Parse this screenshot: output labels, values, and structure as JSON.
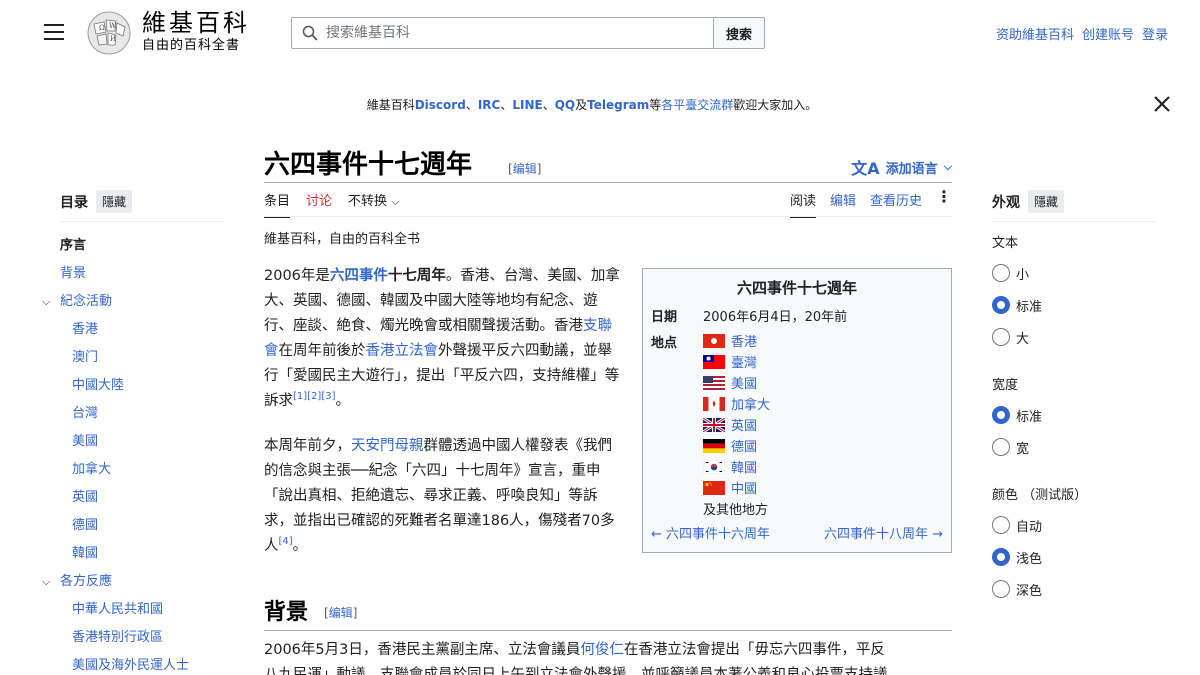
{
  "header": {
    "wordmark_title": "維基百科",
    "wordmark_tagline": "自由的百科全書",
    "search_placeholder": "搜索維基百科",
    "search_button": "搜索",
    "user_links": [
      "资助維基百科",
      "创建账号",
      "登录"
    ]
  },
  "banner": {
    "t1": "維基百科",
    "discord": "Discord",
    "sep1": "、",
    "irc": "IRC",
    "sep2": "、",
    "line": "LINE",
    "sep3": "、",
    "qq": "QQ",
    "and": "及",
    "telegram": "Telegram",
    "etc": "等",
    "platform_link": "各平臺交流群",
    "tail": "歡迎大家加入。"
  },
  "toc": {
    "title": "目录",
    "hide": "隱藏",
    "items": [
      {
        "label": "序言"
      },
      {
        "label": "背景"
      },
      {
        "label": "紀念活動"
      },
      {
        "label": "香港"
      },
      {
        "label": "澳门"
      },
      {
        "label": "中國大陸"
      },
      {
        "label": "台灣"
      },
      {
        "label": "美國"
      },
      {
        "label": "加拿大"
      },
      {
        "label": "英國"
      },
      {
        "label": "德國"
      },
      {
        "label": "韓國"
      },
      {
        "label": "各方反應"
      },
      {
        "label": "中華人民共和國"
      },
      {
        "label": "香港特別行政區"
      },
      {
        "label": "美國及海外民運人士"
      }
    ]
  },
  "article": {
    "title": "六四事件十七週年",
    "edit": "编辑",
    "add_languages": "添加语言",
    "tabs_left": [
      "条目",
      "讨论",
      "不转换"
    ],
    "tabs_right": [
      "阅读",
      "编辑",
      "查看历史"
    ],
    "from": "維基百科，自由的百科全书",
    "p1": {
      "a": "2006年是",
      "link1": "六四事件",
      "b": "十七周年",
      "c": "。香港、台灣、美國、加拿大、英國、德國、韓國及中國大陸等地均有紀念、遊行、座談、絶食、燭光晚會或相關聲援活動。香港",
      "link2": "支聯會",
      "d": "在周年前後於",
      "link3": "香港立法會",
      "e": "外聲援平反六四動議，並舉行「愛國民主大遊行」，提出「平反六四，支持維權」等訴求",
      "refs": "[1][2][3]",
      "f": "。"
    },
    "p2": {
      "a": "本周年前夕，",
      "link1": "天安門母親",
      "b": "群體透過中國人權發表《我們的信念與主張──紀念「六四」十七周年》宣言，重申「說出真相、拒絶遺忘、尋求正義、呼喚良知」等訴求，並指出已確認的死難者名單達186人，傷殘者70多人",
      "ref": "[4]",
      "c": "。"
    },
    "section_title": "背景",
    "section_edit": "编辑",
    "p3": {
      "a": "2006年5月3日，香港民主黨副主席、立法會議員",
      "link": "何俊仁",
      "b": "在香港立法會提出「毋忘六四事件，平反",
      "second_line": "八九民運」動議，支聯會成員於同日上午到立法會外聲援，並呼籲議員本著公義和良心投票支持議"
    }
  },
  "infobox": {
    "title": "六四事件十七週年",
    "date_label": "日期",
    "date_value": "2006年6月4日，20年前",
    "loc_label": "地点",
    "locations": [
      "香港",
      "臺灣",
      "美國",
      "加拿大",
      "英國",
      "德國",
      "韓國",
      "中國"
    ],
    "other": "及其他地方",
    "prev": "← 六四事件十六周年",
    "next": "六四事件十八周年 →"
  },
  "appearance": {
    "title": "外观",
    "hide": "隱藏",
    "text_label": "文本",
    "text_options": [
      "小",
      "标准",
      "大"
    ],
    "text_selected": "标准",
    "width_label": "宽度",
    "width_options": [
      "标准",
      "宽"
    ],
    "width_selected": "标准",
    "color_label": "颜色 （测试版）",
    "color_options": [
      "自动",
      "浅色",
      "深色"
    ],
    "color_selected": "浅色"
  },
  "colors": {
    "link": "#3366cc",
    "talk": "#d73333",
    "text": "#202122"
  }
}
